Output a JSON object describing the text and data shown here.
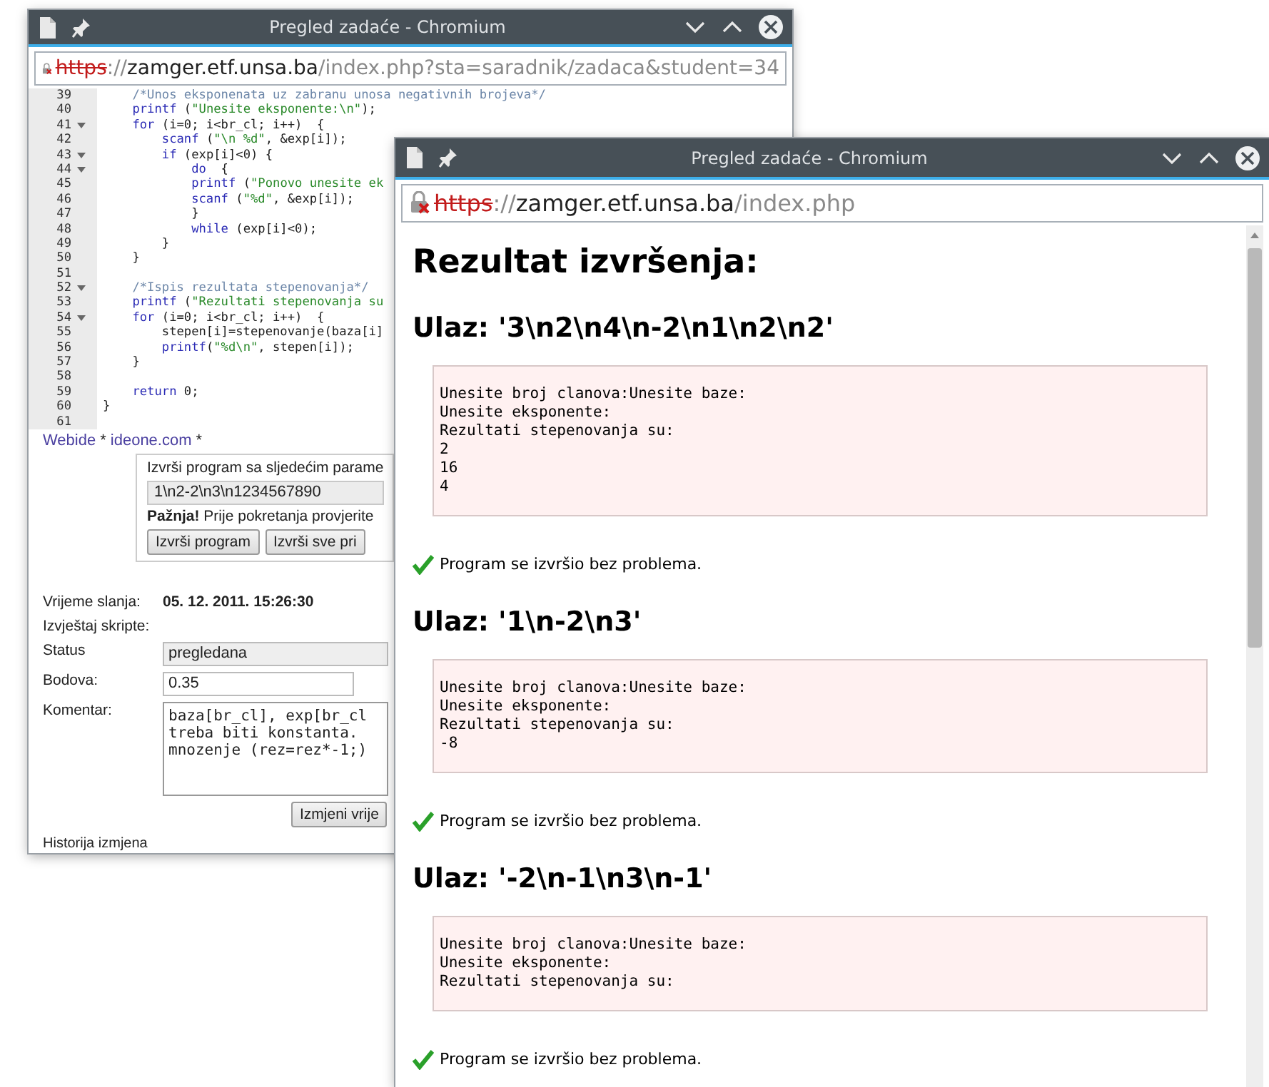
{
  "back_window": {
    "title": "Pregled zadaće - Chromium",
    "url": {
      "scheme": "https",
      "separator": "://",
      "host": "zamger.etf.unsa.ba",
      "path": "/index.php?sta=saradnik/zadaca&student=34"
    },
    "editor": {
      "lines": [
        {
          "number": "39",
          "foldable": false,
          "tokens": [
            {
              "kind": "comment",
              "text": "    /*Unos eksponenata uz zabranu unosa negativnih brojeva*/"
            }
          ]
        },
        {
          "number": "40",
          "foldable": false,
          "tokens": [
            {
              "kind": "keyword",
              "text": "    printf"
            },
            {
              "kind": "plain",
              "text": " ("
            },
            {
              "kind": "string",
              "text": "\"Unesite eksponente:\\n\""
            },
            {
              "kind": "plain",
              "text": ");"
            }
          ]
        },
        {
          "number": "41",
          "foldable": true,
          "tokens": [
            {
              "kind": "keyword",
              "text": "    for"
            },
            {
              "kind": "plain",
              "text": " (i=0; i<br_cl; i++)  {"
            }
          ]
        },
        {
          "number": "42",
          "foldable": false,
          "tokens": [
            {
              "kind": "keyword",
              "text": "        scanf"
            },
            {
              "kind": "plain",
              "text": " ("
            },
            {
              "kind": "string",
              "text": "\"\\n %d\""
            },
            {
              "kind": "plain",
              "text": ", &exp[i]);"
            }
          ]
        },
        {
          "number": "43",
          "foldable": true,
          "tokens": [
            {
              "kind": "keyword",
              "text": "        if"
            },
            {
              "kind": "plain",
              "text": " (exp[i]<0) {"
            }
          ]
        },
        {
          "number": "44",
          "foldable": true,
          "tokens": [
            {
              "kind": "keyword",
              "text": "            do"
            },
            {
              "kind": "plain",
              "text": "  {"
            }
          ]
        },
        {
          "number": "45",
          "foldable": false,
          "tokens": [
            {
              "kind": "keyword",
              "text": "            printf"
            },
            {
              "kind": "plain",
              "text": " ("
            },
            {
              "kind": "string",
              "text": "\"Ponovo unesite ek"
            }
          ]
        },
        {
          "number": "46",
          "foldable": false,
          "tokens": [
            {
              "kind": "keyword",
              "text": "            scanf"
            },
            {
              "kind": "plain",
              "text": " ("
            },
            {
              "kind": "string",
              "text": "\"%d\""
            },
            {
              "kind": "plain",
              "text": ", &exp[i]);"
            }
          ]
        },
        {
          "number": "47",
          "foldable": false,
          "tokens": [
            {
              "kind": "plain",
              "text": "            }"
            }
          ]
        },
        {
          "number": "48",
          "foldable": false,
          "tokens": [
            {
              "kind": "keyword",
              "text": "            while"
            },
            {
              "kind": "plain",
              "text": " (exp[i]<0);"
            }
          ]
        },
        {
          "number": "49",
          "foldable": false,
          "tokens": [
            {
              "kind": "plain",
              "text": "        }"
            }
          ]
        },
        {
          "number": "50",
          "foldable": false,
          "tokens": [
            {
              "kind": "plain",
              "text": "    }"
            }
          ]
        },
        {
          "number": "51",
          "foldable": false
        },
        {
          "number": "52",
          "foldable": true,
          "tokens": [
            {
              "kind": "comment",
              "text": "    /*Ispis rezultata stepenovanja*/"
            }
          ]
        },
        {
          "number": "53",
          "foldable": false,
          "tokens": [
            {
              "kind": "keyword",
              "text": "    printf"
            },
            {
              "kind": "plain",
              "text": " ("
            },
            {
              "kind": "string",
              "text": "\"Rezultati stepenovanja su"
            }
          ]
        },
        {
          "number": "54",
          "foldable": true,
          "tokens": [
            {
              "kind": "keyword",
              "text": "    for"
            },
            {
              "kind": "plain",
              "text": " (i=0; i<br_cl; i++)  {"
            }
          ]
        },
        {
          "number": "55",
          "foldable": false,
          "tokens": [
            {
              "kind": "plain",
              "text": "        stepen[i]=stepenovanje(baza[i]"
            }
          ]
        },
        {
          "number": "56",
          "foldable": false,
          "tokens": [
            {
              "kind": "keyword",
              "text": "        printf"
            },
            {
              "kind": "plain",
              "text": "("
            },
            {
              "kind": "string",
              "text": "\"%d\\n\""
            },
            {
              "kind": "plain",
              "text": ", stepen[i]);"
            }
          ]
        },
        {
          "number": "57",
          "foldable": false,
          "tokens": [
            {
              "kind": "plain",
              "text": "    }"
            }
          ]
        },
        {
          "number": "58",
          "foldable": false
        },
        {
          "number": "59",
          "foldable": false,
          "tokens": [
            {
              "kind": "keyword",
              "text": "    return"
            },
            {
              "kind": "plain",
              "text": " 0;"
            }
          ]
        },
        {
          "number": "60",
          "foldable": false,
          "tokens": [
            {
              "kind": "plain",
              "text": "}"
            }
          ]
        },
        {
          "number": "61",
          "foldable": false
        }
      ]
    },
    "tool_links": [
      {
        "kind": "link",
        "text": "Webide"
      },
      {
        "kind": "separator",
        "text": "*"
      },
      {
        "kind": "link",
        "text": "ideone.com"
      },
      {
        "kind": "separator",
        "text": "*"
      }
    ],
    "run_panel": {
      "caption": "Izvrši program sa sljedećim parame",
      "input_value": "1\\n2-2\\n3\\n1234567890",
      "warning": "**Pažnja!** Prije pokretanja provjerite",
      "buttons": [
        "Izvrši program",
        "Izvrši sve pri"
      ]
    },
    "details": {
      "sent_label": "Vrijeme slanja:",
      "sent_value": "05. 12. 2011. 15:26:30",
      "report_label": "Izvještaj skripte:",
      "fields": [
        {
          "kind": "select",
          "label": "Status",
          "value": "pregledana"
        },
        {
          "kind": "input",
          "label": "Bodova:",
          "value": "0.35"
        },
        {
          "kind": "textarea",
          "label": "Komentar:",
          "value": "baza[br_cl], exp[br_cl\ntreba biti konstanta.\nmnozenje (rez=rez*-1;)"
        }
      ],
      "button": "Izmjeni vrije",
      "history": "Historija izmjena"
    }
  },
  "front_window": {
    "title": "Pregled zadaće - Chromium",
    "url": {
      "scheme": "https",
      "separator": "://",
      "host": "zamger.etf.unsa.ba",
      "path": "/index.php"
    },
    "heading": "Rezultat izvršenja:",
    "runs": [
      {
        "input": "Ulaz: '3\\n2\\n4\\n-2\\n1\\n2\\n2'",
        "output": "Unesite broj clanova:Unesite baze:\nUnesite eksponente:\nRezultati stepenovanja su:\n2\n16\n4",
        "status": "Program se izvršio bez problema."
      },
      {
        "input": "Ulaz: '1\\n-2\\n3'",
        "output": "Unesite broj clanova:Unesite baze:\nUnesite eksponente:\nRezultati stepenovanja su:\n-8",
        "status": "Program se izvršio bez problema."
      },
      {
        "input": "Ulaz: '-2\\n-1\\n3\\n-1'",
        "output": "Unesite broj clanova:Unesite baze:\nUnesite eksponente:\nRezultati stepenovanja su:",
        "status": "Program se izvršio bez problema."
      }
    ]
  }
}
